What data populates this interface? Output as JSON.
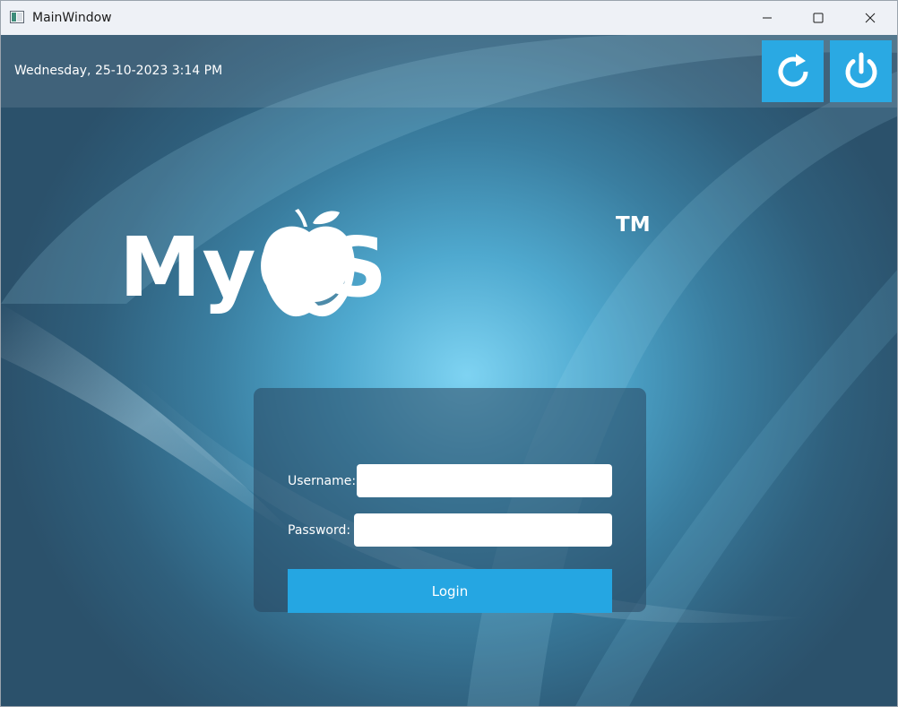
{
  "window": {
    "title": "MainWindow"
  },
  "header": {
    "datetime": "Wednesday, 25-10-2023 3:14 PM",
    "restart_icon": "restart-icon",
    "power_icon": "power-icon"
  },
  "logo": {
    "icon": "apple-icon",
    "text": "MyOS",
    "trademark": "TM"
  },
  "login": {
    "username_label": "Username:",
    "username_value": "",
    "password_label": "Password:",
    "password_value": "",
    "login_label": "Login"
  },
  "colors": {
    "accent": "#25a6e2",
    "panel": "#28465f",
    "background_center": "#7ed3f2",
    "background_edge": "#2b516b"
  }
}
